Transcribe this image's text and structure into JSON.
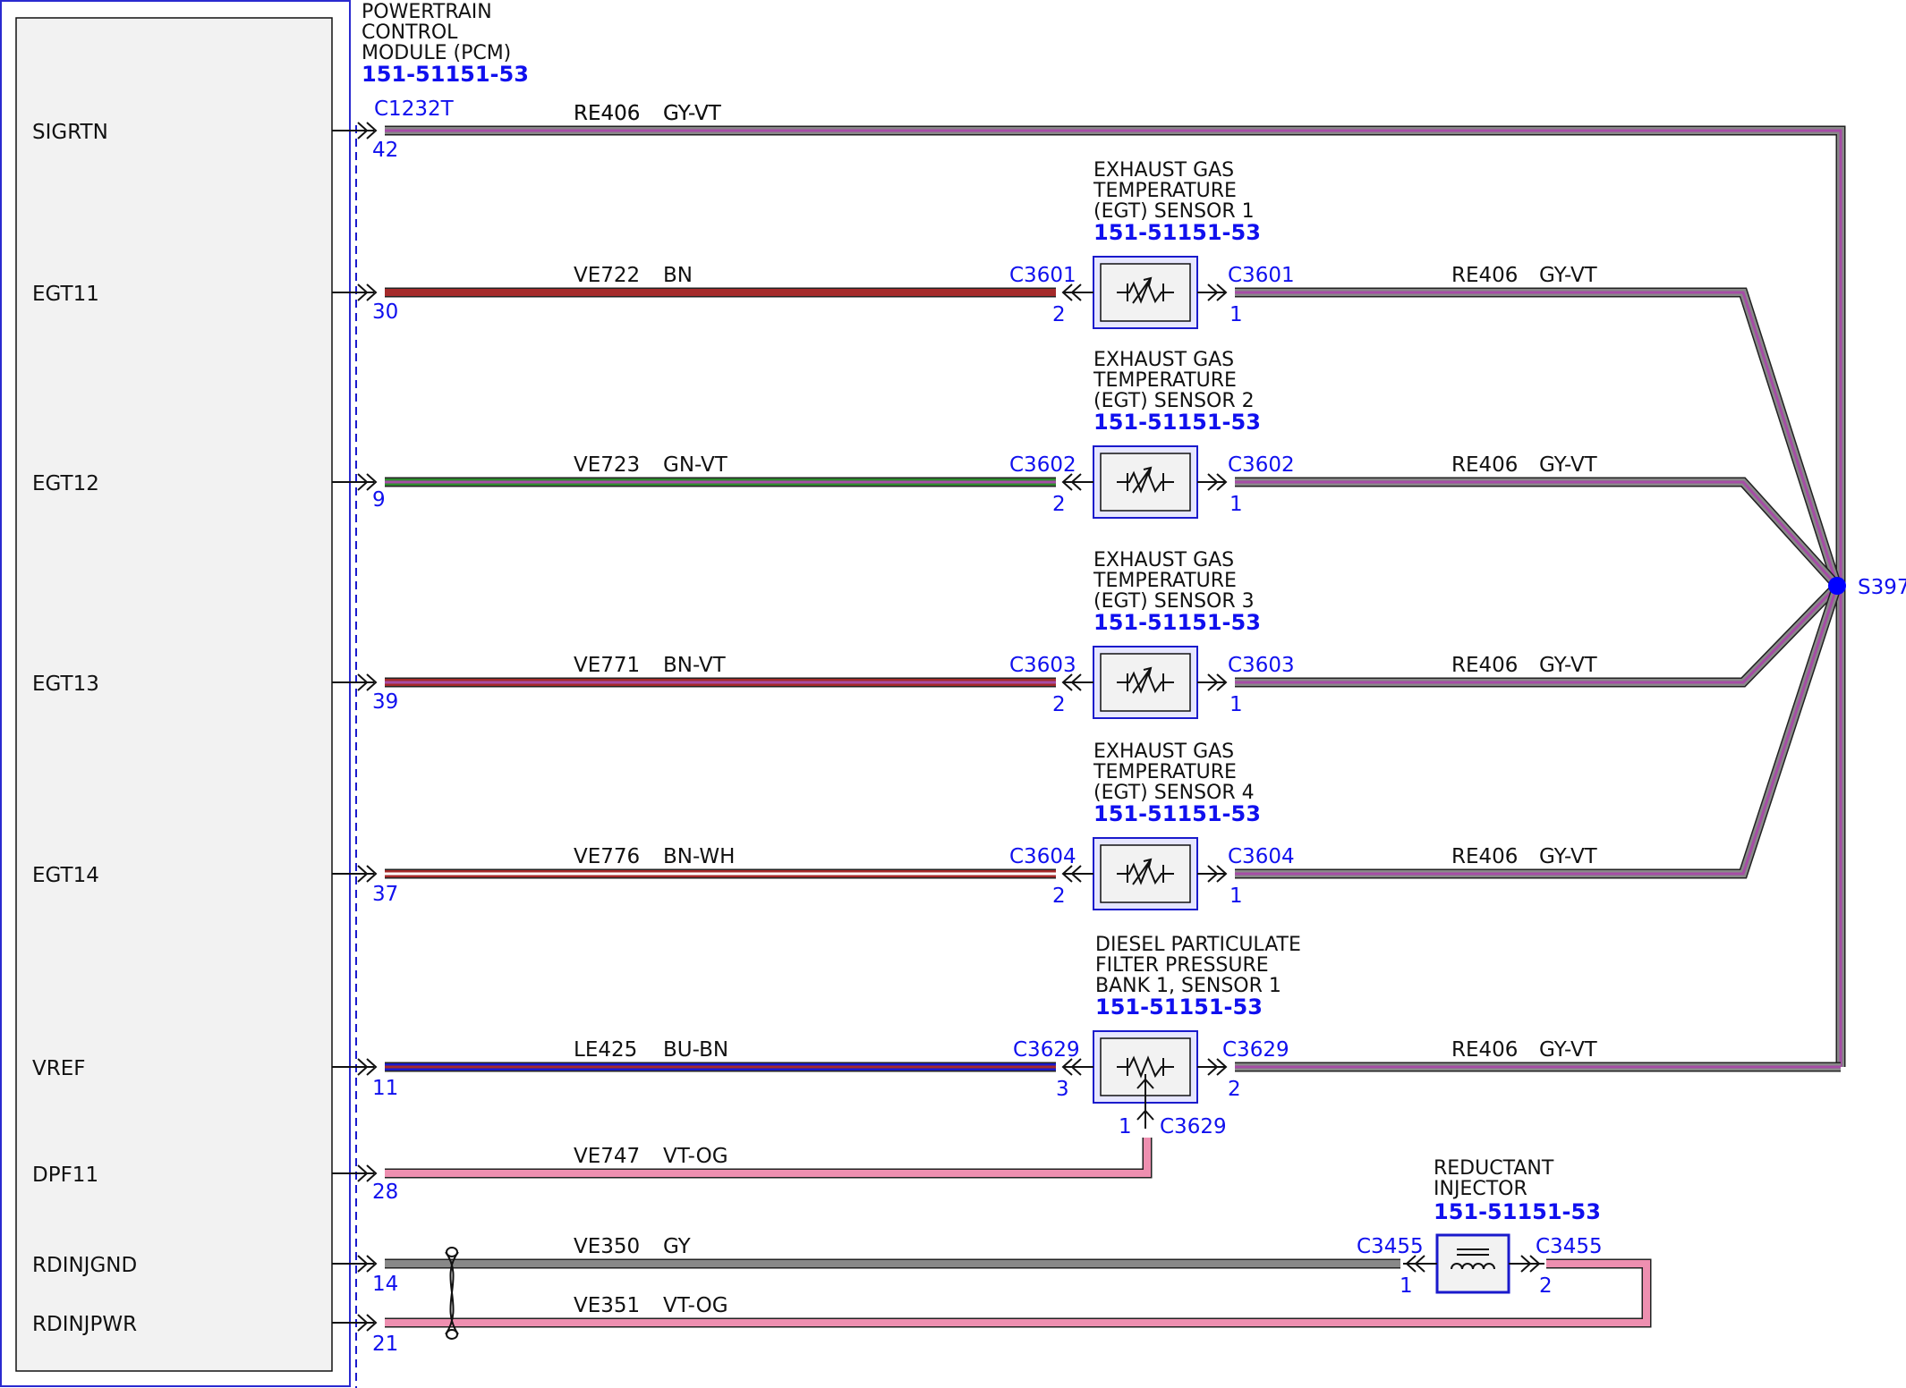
{
  "pcm": {
    "title_lines": [
      "POWERTRAIN",
      "CONTROL",
      "MODULE (PCM)"
    ],
    "ref": "151-51151-53",
    "connector": "C1232T"
  },
  "splice": {
    "label": "S397",
    "color": "#0000ff"
  },
  "signals": [
    {
      "name": "SIGRTN",
      "pin": "42",
      "circuit": "RE406",
      "color_code": "GY-VT",
      "wire_colors": [
        "#888888",
        "#a64ca6"
      ]
    },
    {
      "name": "EGT11",
      "pin": "30",
      "circuit": "VE722",
      "color_code": "BN",
      "wire_colors": [
        "#a52a2a"
      ]
    },
    {
      "name": "EGT12",
      "pin": "9",
      "circuit": "VE723",
      "color_code": "GN-VT",
      "wire_colors": [
        "#2e8b2e",
        "#a64ca6"
      ]
    },
    {
      "name": "EGT13",
      "pin": "39",
      "circuit": "VE771",
      "color_code": "BN-VT",
      "wire_colors": [
        "#a52a2a",
        "#a64ca6"
      ]
    },
    {
      "name": "EGT14",
      "pin": "37",
      "circuit": "VE776",
      "color_code": "BN-WH",
      "wire_colors": [
        "#a52a2a",
        "#ffffff"
      ]
    },
    {
      "name": "VREF",
      "pin": "11",
      "circuit": "LE425",
      "color_code": "BU-BN",
      "wire_colors": [
        "#1a1acc",
        "#a52a2a"
      ]
    },
    {
      "name": "DPF11",
      "pin": "28",
      "circuit": "VE747",
      "color_code": "VT-OG",
      "wire_colors": [
        "#ee8fb0"
      ]
    },
    {
      "name": "RDINJGND",
      "pin": "14",
      "circuit": "VE350",
      "color_code": "GY",
      "wire_colors": [
        "#888888"
      ]
    },
    {
      "name": "RDINJPWR",
      "pin": "21",
      "circuit": "VE351",
      "color_code": "VT-OG",
      "wire_colors": [
        "#ee8fb0"
      ]
    }
  ],
  "sensors": [
    {
      "title_lines": [
        "EXHAUST GAS",
        "TEMPERATURE",
        "(EGT) SENSOR 1"
      ],
      "ref": "151-51151-53",
      "connector": "C3601",
      "pin_in": "2",
      "pin_out": "1",
      "out_circuit": "RE406",
      "out_color_code": "GY-VT"
    },
    {
      "title_lines": [
        "EXHAUST GAS",
        "TEMPERATURE",
        "(EGT) SENSOR 2"
      ],
      "ref": "151-51151-53",
      "connector": "C3602",
      "pin_in": "2",
      "pin_out": "1",
      "out_circuit": "RE406",
      "out_color_code": "GY-VT"
    },
    {
      "title_lines": [
        "EXHAUST GAS",
        "TEMPERATURE",
        "(EGT) SENSOR 3"
      ],
      "ref": "151-51151-53",
      "connector": "C3603",
      "pin_in": "2",
      "pin_out": "1",
      "out_circuit": "RE406",
      "out_color_code": "GY-VT"
    },
    {
      "title_lines": [
        "EXHAUST GAS",
        "TEMPERATURE",
        "(EGT) SENSOR 4"
      ],
      "ref": "151-51151-53",
      "connector": "C3604",
      "pin_in": "2",
      "pin_out": "1",
      "out_circuit": "RE406",
      "out_color_code": "GY-VT"
    }
  ],
  "dpf_sensor": {
    "title_lines": [
      "DIESEL PARTICULATE",
      "FILTER PRESSURE",
      "BANK 1, SENSOR 1"
    ],
    "ref": "151-51151-53",
    "connector": "C3629",
    "pin_in": "3",
    "pin_out": "2",
    "pin_bottom": "1",
    "out_circuit": "RE406",
    "out_color_code": "GY-VT"
  },
  "injector": {
    "title_lines": [
      "REDUCTANT",
      "INJECTOR"
    ],
    "ref": "151-51151-53",
    "connector": "C3455",
    "pin_left": "1",
    "pin_right": "2"
  }
}
